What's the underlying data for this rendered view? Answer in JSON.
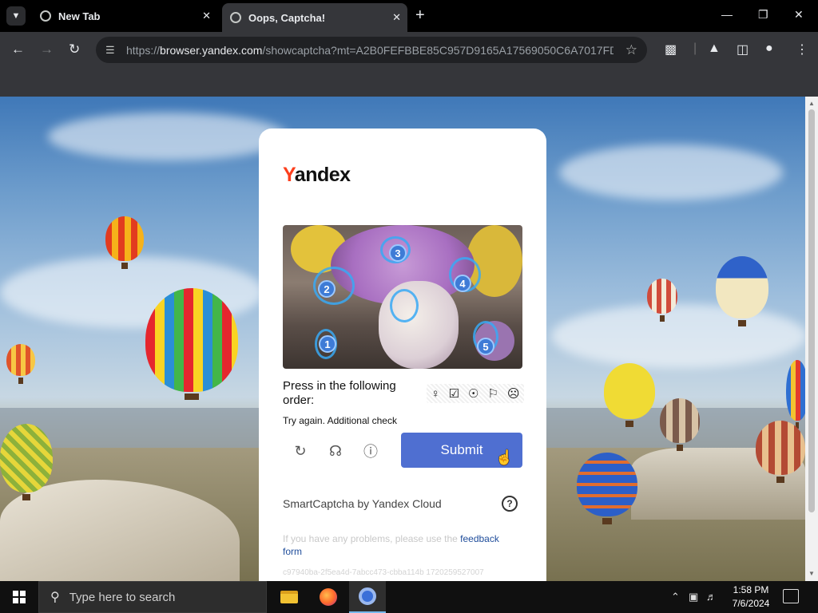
{
  "tabs": [
    {
      "title": "New Tab",
      "active": false
    },
    {
      "title": "Oops, Captcha!",
      "active": true
    }
  ],
  "toolbar": {
    "url_scheme": "https://",
    "url_host": "browser.yandex.com",
    "url_rest": "/showcaptcha?mt=A2B0FEFBBE85C957D9165A17569050C6A7017FD3..."
  },
  "captcha": {
    "logo_first": "Y",
    "logo_rest": "andex",
    "instruction": "Press in the following order:",
    "order_icons": [
      "♀",
      "☑",
      "☉",
      "⚐",
      "☹"
    ],
    "markers": [
      "1",
      "2",
      "3",
      "4",
      "5"
    ],
    "try_again": "Try again. Additional check",
    "submit_label": "Submit",
    "branding": "SmartCaptcha by Yandex Cloud",
    "help_glyph": "?",
    "problems_text": "If you have any problems, please use the",
    "feedback_link": "feedback form",
    "hash": "c97940ba-2f5ea4d-7abcc473-cbba114b 1720259527007"
  },
  "taskbar": {
    "search_placeholder": "Type here to search",
    "time": "1:58 PM",
    "date": "7/6/2024"
  },
  "icons": {
    "refresh": "↻",
    "audio": "☊",
    "info": "ⓘ"
  }
}
